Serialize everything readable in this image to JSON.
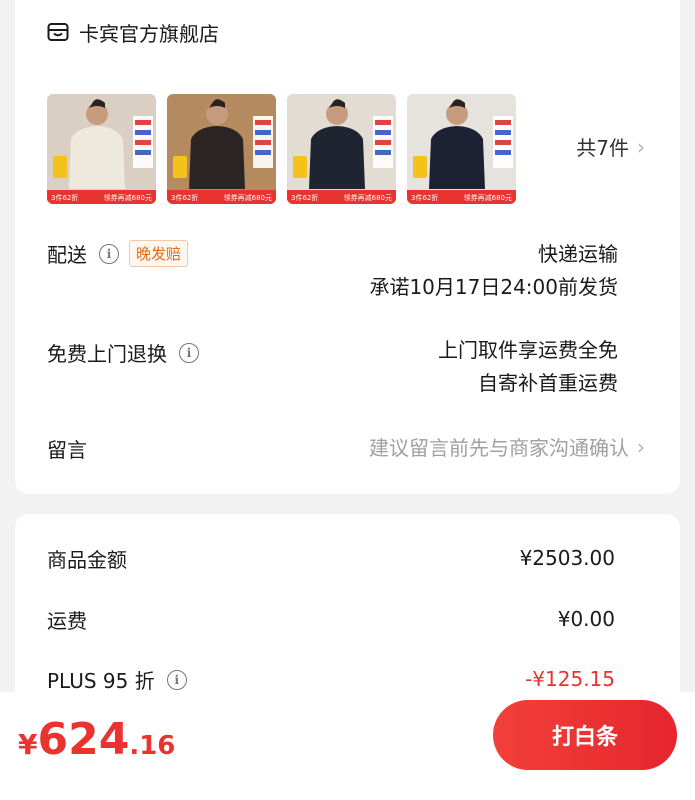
{
  "store": {
    "name": "卡宾官方旗舰店",
    "icon": "store-icon"
  },
  "products": {
    "thumbnails": [
      {
        "name": "product-thumb-1",
        "bg": "#d9cfc2",
        "garment": "#efe8dc",
        "banner_left": "3件62折",
        "banner_right": "领券再减680元"
      },
      {
        "name": "product-thumb-2",
        "bg": "#b58a5f",
        "garment": "#2b2624",
        "banner_left": "3件62折",
        "banner_right": "领券再减680元"
      },
      {
        "name": "product-thumb-3",
        "bg": "#e2dcd2",
        "garment": "#1f2530",
        "banner_left": "3件62折",
        "banner_right": "领券再减680元"
      },
      {
        "name": "product-thumb-4",
        "bg": "#e6e3de",
        "garment": "#1c2233",
        "banner_left": "3件62折",
        "banner_right": "领券再减680元"
      }
    ],
    "count_text": "共7件",
    "accent": "#e8332f"
  },
  "delivery": {
    "label": "配送",
    "badge": "晚发赔",
    "method": "快递运输",
    "promise": "承诺10月17日24:00前发货"
  },
  "returns": {
    "label": "免费上门退换",
    "line1": "上门取件享运费全免",
    "line2": "自寄补首重运费"
  },
  "message": {
    "label": "留言",
    "placeholder": "建议留言前先与商家沟通确认"
  },
  "amounts": {
    "goods_label": "商品金额",
    "goods_value": "¥2503.00",
    "shipping_label": "运费",
    "shipping_value": "¥0.00",
    "plus_label": "PLUS 95 折",
    "plus_value": "-¥125.15"
  },
  "footer": {
    "currency": "¥",
    "price_int": "624",
    "price_dec": ".16",
    "pay_label": "打白条"
  }
}
